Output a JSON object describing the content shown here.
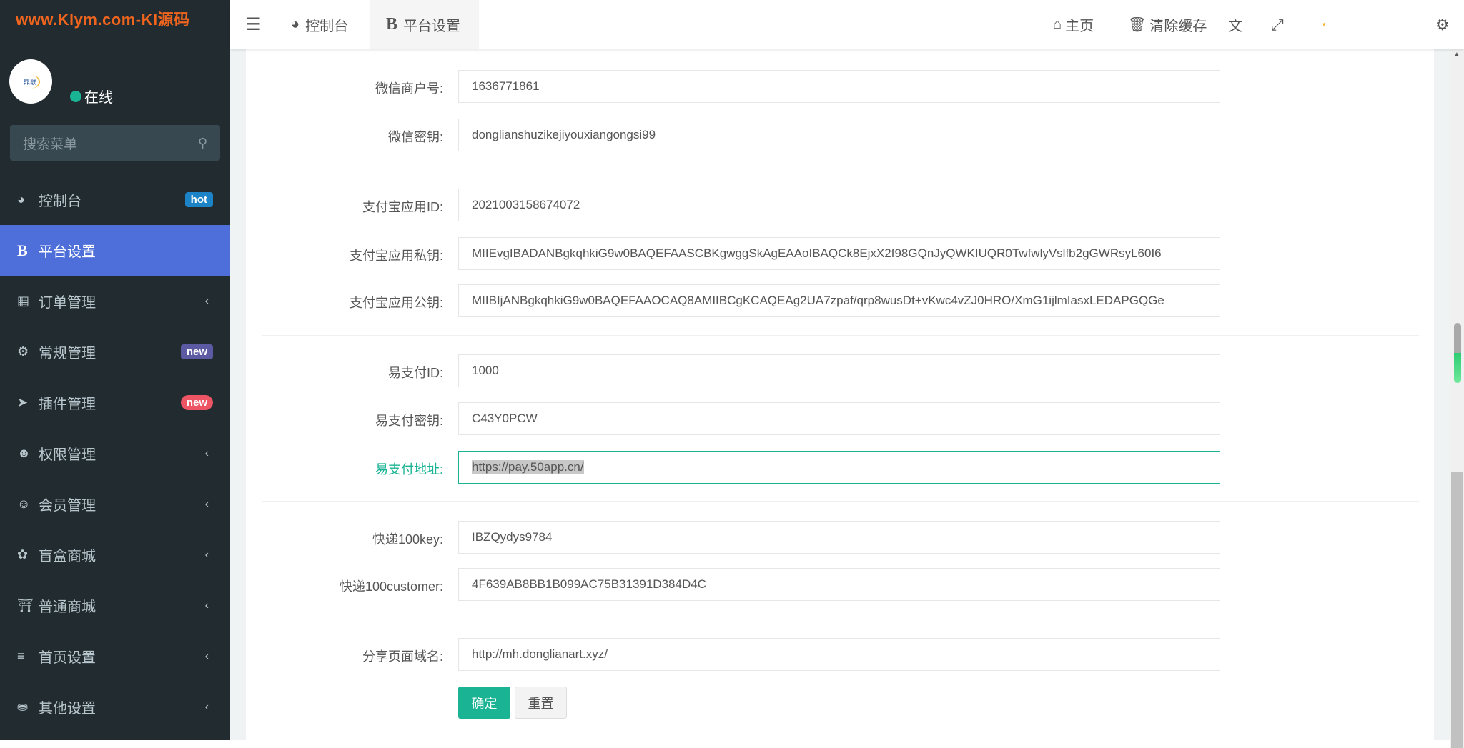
{
  "watermark": "www.Klym.com-KI源码",
  "sidebar": {
    "avatar_text": "鼎联",
    "status": "在线",
    "search_placeholder": "搜索菜单",
    "items": [
      {
        "label": "控制台",
        "icon": "dashboard-icon",
        "badge": "hot"
      },
      {
        "label": "平台设置",
        "icon": "bold-b-icon",
        "active": true
      },
      {
        "label": "订单管理",
        "icon": "calculator-icon"
      },
      {
        "label": "常规管理",
        "icon": "cogs-icon",
        "badge": "new"
      },
      {
        "label": "插件管理",
        "icon": "rocket-icon",
        "badge": "new"
      },
      {
        "label": "权限管理",
        "icon": "users-icon"
      },
      {
        "label": "会员管理",
        "icon": "user-circle-icon"
      },
      {
        "label": "盲盒商城",
        "icon": "hearing-icon"
      },
      {
        "label": "普通商城",
        "icon": "bank-icon"
      },
      {
        "label": "首页设置",
        "icon": "list-icon"
      },
      {
        "label": "其他设置",
        "icon": "database-icon"
      }
    ]
  },
  "header": {
    "tabs": [
      {
        "label": "控制台"
      },
      {
        "label": "平台设置"
      }
    ],
    "home": "主页",
    "clear_cache": "清除缓存"
  },
  "form": {
    "fields": [
      {
        "label": "微信商户号:",
        "value": "1636771861"
      },
      {
        "label": "微信密钥:",
        "value": "donglianshuzikejiyouxiangongsi99"
      },
      {
        "label": "支付宝应用ID:",
        "value": "2021003158674072"
      },
      {
        "label": "支付宝应用私钥:",
        "value": "MIIEvgIBADANBgkqhkiG9w0BAQEFAASCBKgwggSkAgEAAoIBAQCk8EjxX2f98GQnJyQWKIUQR0TwfwlyVslfb2gGWRsyL60I6"
      },
      {
        "label": "支付宝应用公钥:",
        "value": "MIIBIjANBgkqhkiG9w0BAQEFAAOCAQ8AMIIBCgKCAQEAg2UA7zpaf/qrp8wusDt+vKwc4vZJ0HRO/XmG1ijlmIasxLEDAPGQGe"
      },
      {
        "label": "易支付ID:",
        "value": "1000"
      },
      {
        "label": "易支付密钥:",
        "value": "C43Y0PCW"
      },
      {
        "label": "易支付地址:",
        "value": "https://pay.50app.cn/"
      },
      {
        "label": "快递100key:",
        "value": "IBZQydys9784"
      },
      {
        "label": "快递100customer:",
        "value": "4F639AB8BB1B099AC75B31391D384D4C"
      },
      {
        "label": "分享页面域名:",
        "value": "http://mh.donglianart.xyz/"
      }
    ],
    "submit": "确定",
    "reset": "重置"
  }
}
